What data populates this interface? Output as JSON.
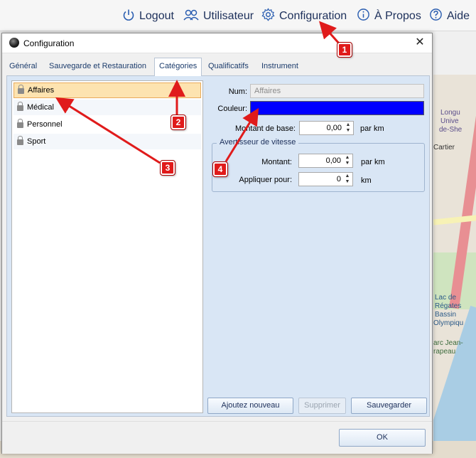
{
  "menubar": {
    "logout": "Logout",
    "user": "Utilisateur",
    "config": "Configuration",
    "about": "À Propos",
    "help": "Aide"
  },
  "dialog": {
    "title": "Configuration",
    "tabs": [
      "Général",
      "Sauvegarde et Restauration",
      "Catégories",
      "Qualificatifs",
      "Instrument"
    ],
    "active_tab": "Catégories",
    "categories": [
      "Affaires",
      "Médical",
      "Personnel",
      "Sport"
    ],
    "selected_category": "Affaires",
    "form": {
      "num_label": "Num:",
      "num_value": "Affaires",
      "color_label": "Couleur:",
      "color_value": "#0000ff",
      "base_amount_label": "Montant de base:",
      "base_amount_value": "0,00",
      "base_amount_unit": "par km",
      "speed_group_label": "Avertisseur de vitesse",
      "amount_label": "Montant:",
      "amount_value": "0,00",
      "amount_unit": "par km",
      "apply_label": "Appliquer pour:",
      "apply_value": "0",
      "apply_unit": "km"
    },
    "buttons": {
      "add": "Ajoutez nouveau",
      "delete": "Supprimer",
      "save": "Sauvegarder",
      "ok": "OK"
    }
  },
  "map_labels": {
    "l1": "Longu",
    "l2": "Unive",
    "l3": "de-She",
    "l4": "Cartier",
    "l5": "Lac de",
    "l6": "Régates",
    "l7": "Bassin",
    "l8": "Olympiqu",
    "l9": "arc Jean-",
    "l10": "rapeau"
  },
  "annotations": [
    "1",
    "2",
    "3",
    "4"
  ],
  "colors": {
    "annotation": "#e01b1b",
    "selection": "#fde3b0",
    "panel": "#d9e6f5"
  }
}
